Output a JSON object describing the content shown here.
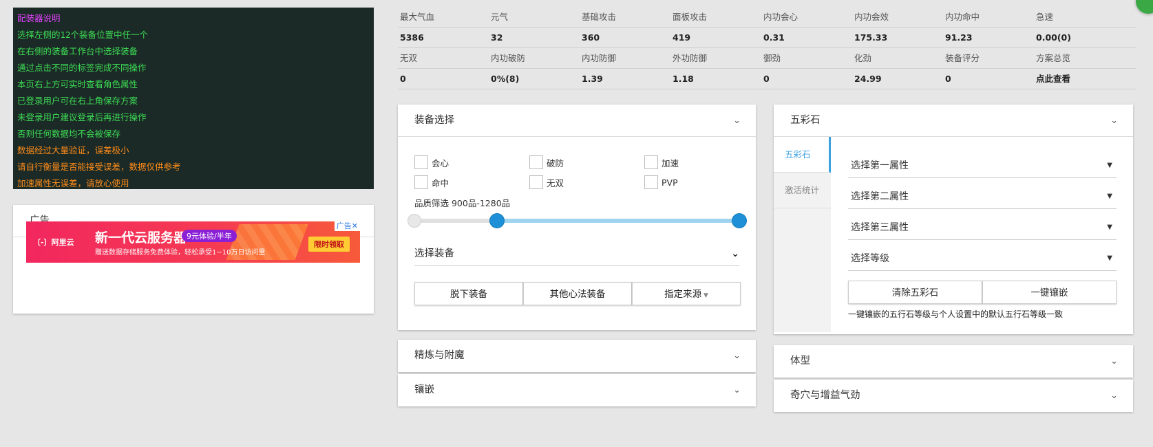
{
  "info_panel": {
    "title": "配装器说明",
    "lines_green": [
      "选择左侧的12个装备位置中任一个",
      "在右侧的装备工作台中选择装备",
      "通过点击不同的标签完成不同操作",
      "本页右上方可实时查看角色属性",
      "已登录用户可在右上角保存方案",
      "未登录用户建议登录后再进行操作",
      "否则任何数据均不会被保存"
    ],
    "lines_orange": [
      "数据经过大量验证，误差极小",
      "请自行衡量是否能接受误差，数据仅供参考",
      "加速属性无误差，请放心使用"
    ],
    "colors": {
      "background": "#1b2a26",
      "title": "#e040fb",
      "green": "#3ddc55",
      "orange": "#ff8c1a"
    }
  },
  "ad_card": {
    "title": "广告",
    "banner": {
      "logo": "〔-〕阿里云",
      "headline": "新一代云服务器",
      "tag": "9元体验/半年",
      "subline": "赠送数据存储服务免费体验，轻松承受1~10万日访问量",
      "cta": "限时领取",
      "corner": "广告✕"
    }
  },
  "stats": {
    "row1_labels": [
      "最大气血",
      "元气",
      "基础攻击",
      "面板攻击",
      "内功会心",
      "内功会效",
      "内功命中",
      "急速"
    ],
    "row1_values": [
      "5386",
      "32",
      "360",
      "419",
      "0.31",
      "175.33",
      "91.23",
      "0.00(0)"
    ],
    "row2_labels": [
      "无双",
      "内功破防",
      "内功防御",
      "外功防御",
      "御劲",
      "化劲",
      "装备评分",
      "方案总览"
    ],
    "row2_values": [
      "0",
      "0%(8)",
      "1.39",
      "1.18",
      "0",
      "24.99",
      "0",
      "点此查看"
    ]
  },
  "equip_card": {
    "title": "装备选择",
    "checkboxes_row1": [
      "会心",
      "破防",
      "加速"
    ],
    "checkboxes_row2": [
      "命中",
      "无双",
      "PVP"
    ],
    "quality_label": "品质筛选 900品-1280品",
    "quality_min": 900,
    "quality_max": 1280,
    "select_label": "选择装备",
    "buttons": [
      "脱下装备",
      "其他心法装备",
      "指定来源"
    ]
  },
  "refine_card": {
    "title": "精炼与附魔"
  },
  "inlay_card": {
    "title": "镶嵌"
  },
  "gem_card": {
    "title": "五彩石",
    "tabs": [
      "五彩石",
      "激活统计"
    ],
    "selects": [
      "选择第一属性",
      "选择第二属性",
      "选择第三属性",
      "选择等级"
    ],
    "buttons": [
      "清除五彩石",
      "一键镶嵌"
    ],
    "note": "一键镶嵌的五行石等级与个人设置中的默认五行石等级一致"
  },
  "body_card": {
    "title": "体型"
  },
  "qixue_card": {
    "title": "奇穴与增益气劲"
  },
  "accent_colors": {
    "primary": "#1e90d8",
    "tab_active": "#3da0e0",
    "slider_fill": "#9fd4ef"
  }
}
